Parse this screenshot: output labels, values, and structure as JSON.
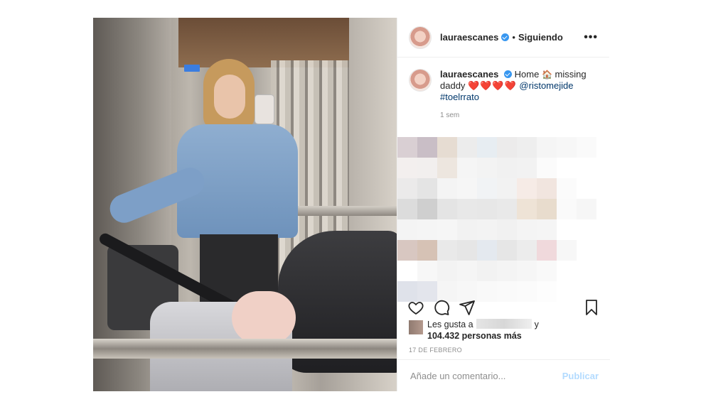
{
  "post": {
    "username": "lauraescanes",
    "follow_status": "Siguiendo",
    "separator": "•",
    "more_label": "•••",
    "caption": {
      "username": "lauraescanes",
      "text_before": "Home",
      "house_emoji": "🏠",
      "text_after": "missing daddy",
      "hearts": "❤️❤️❤️❤️",
      "mention": "@ristomejide",
      "hashtag": "#toelrrato"
    },
    "time_ago": "1 sem",
    "likes": {
      "prefix": "Les gusta a",
      "joiner": "y",
      "count_text": "104.432 personas más"
    },
    "date": "17 DE FEBRERO",
    "comment_placeholder": "Añade un comentario...",
    "publish_label": "Publicar"
  },
  "icons": {
    "like": "heart-icon",
    "comment": "comment-icon",
    "share": "share-icon",
    "save": "bookmark-icon",
    "verified": "verified-badge-icon"
  },
  "colors": {
    "verified": "#3897f0",
    "link": "#00376b",
    "publish_disabled": "#b3dbff",
    "muted": "#8e8e8e"
  }
}
